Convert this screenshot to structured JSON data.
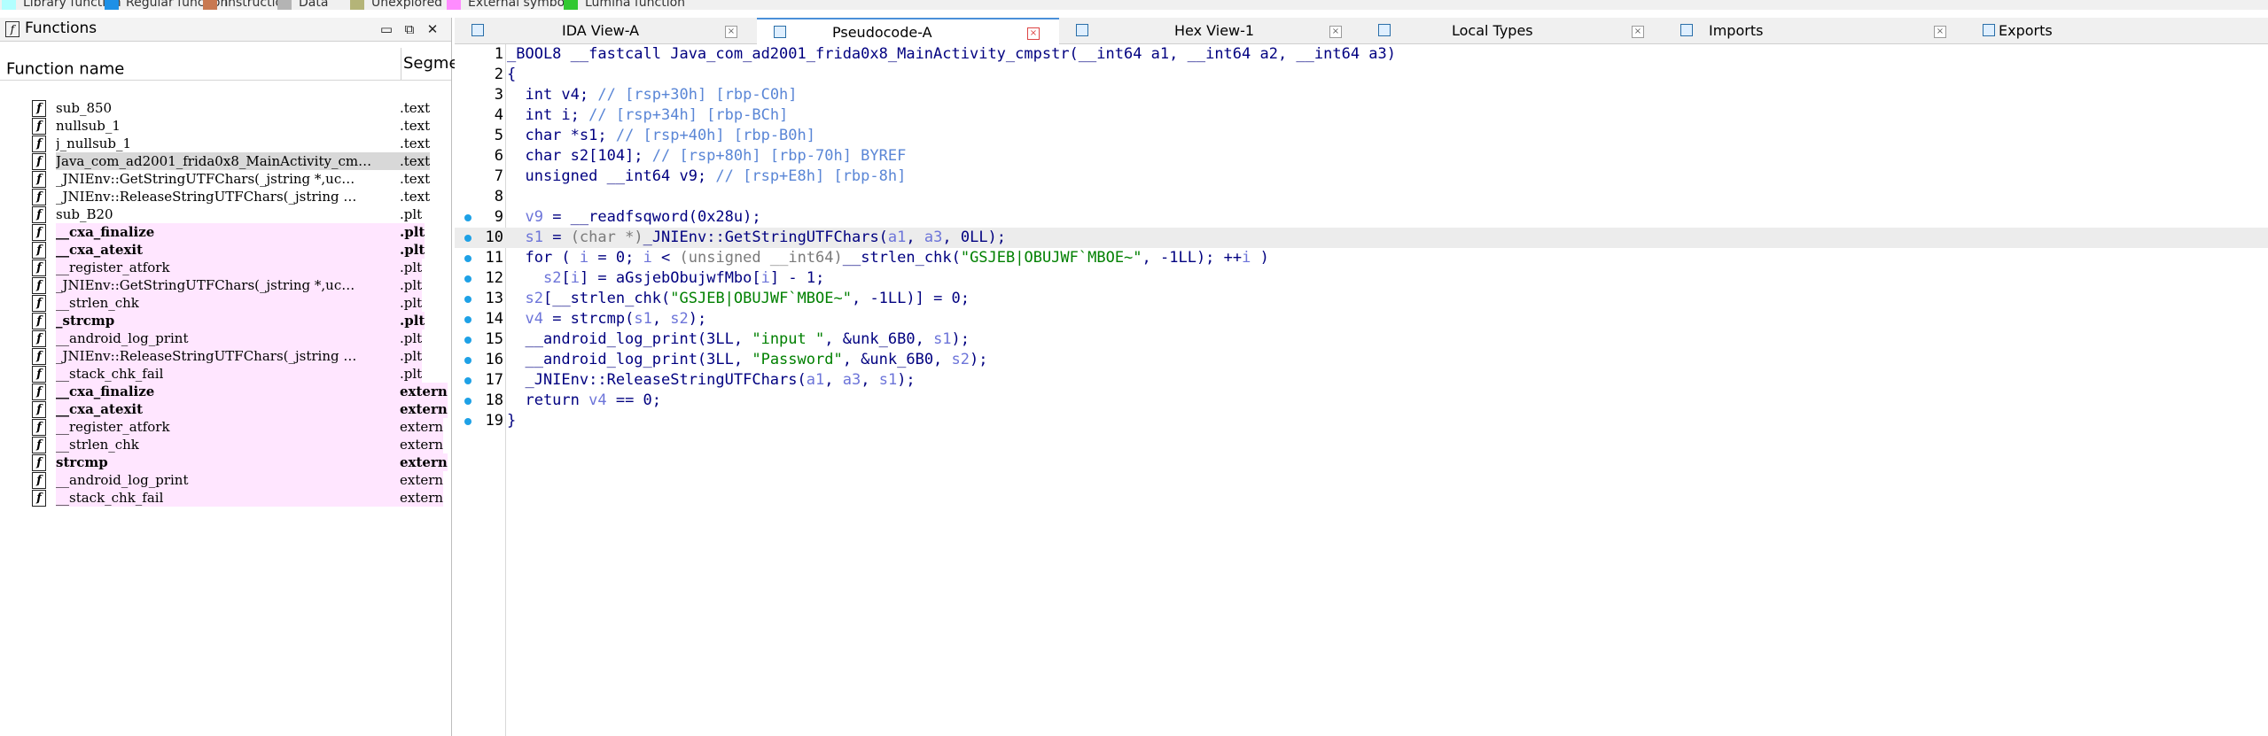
{
  "legend": [
    {
      "label": "Library function",
      "color": "#b2ffff"
    },
    {
      "label": "Regular function",
      "color": "#1e90e6"
    },
    {
      "label": "Instruction",
      "color": "#c87850"
    },
    {
      "label": "Data",
      "color": "#b4b4b4"
    },
    {
      "label": "Unexplored",
      "color": "#b4b478"
    },
    {
      "label": "External symbol",
      "color": "#ff8cff"
    },
    {
      "label": "Lumina function",
      "color": "#32c832"
    }
  ],
  "functions_panel": {
    "title": "Functions",
    "col_name": "Function name",
    "col_segment": "Segme",
    "rows": [
      {
        "name": "sub_850",
        "seg": ".text",
        "style": ""
      },
      {
        "name": "nullsub_1",
        "seg": ".text",
        "style": ""
      },
      {
        "name": "j_nullsub_1",
        "seg": ".text",
        "style": ""
      },
      {
        "name": "Java_com_ad2001_frida0x8_MainActivity_cm…",
        "seg": ".text",
        "style": "sel"
      },
      {
        "name": "_JNIEnv::GetStringUTFChars(_jstring *,uc…",
        "seg": ".text",
        "style": ""
      },
      {
        "name": "_JNIEnv::ReleaseStringUTFChars(_jstring …",
        "seg": ".text",
        "style": ""
      },
      {
        "name": "sub_B20",
        "seg": ".plt",
        "style": ""
      },
      {
        "name": "__cxa_finalize",
        "seg": ".plt",
        "style": "pink bold"
      },
      {
        "name": "__cxa_atexit",
        "seg": ".plt",
        "style": "pink bold"
      },
      {
        "name": "__register_atfork",
        "seg": ".plt",
        "style": "pink"
      },
      {
        "name": "_JNIEnv::GetStringUTFChars(_jstring *,uc…",
        "seg": ".plt",
        "style": "pink"
      },
      {
        "name": "__strlen_chk",
        "seg": ".plt",
        "style": "pink"
      },
      {
        "name": "_strcmp",
        "seg": ".plt",
        "style": "pink bold"
      },
      {
        "name": "__android_log_print",
        "seg": ".plt",
        "style": "pink"
      },
      {
        "name": "_JNIEnv::ReleaseStringUTFChars(_jstring …",
        "seg": ".plt",
        "style": "pink"
      },
      {
        "name": "__stack_chk_fail",
        "seg": ".plt",
        "style": "pink"
      },
      {
        "name": "__cxa_finalize",
        "seg": "extern",
        "style": "pink bold"
      },
      {
        "name": "__cxa_atexit",
        "seg": "extern",
        "style": "pink bold"
      },
      {
        "name": "__register_atfork",
        "seg": "extern",
        "style": "pink"
      },
      {
        "name": "__strlen_chk",
        "seg": "extern",
        "style": "pink"
      },
      {
        "name": "strcmp",
        "seg": "extern",
        "style": "pink bold"
      },
      {
        "name": "__android_log_print",
        "seg": "extern",
        "style": "pink"
      },
      {
        "name": "__stack_chk_fail",
        "seg": "extern",
        "style": "pink"
      }
    ]
  },
  "tabs": [
    {
      "label": "IDA View-A",
      "active": false
    },
    {
      "label": "Pseudocode-A",
      "active": true
    },
    {
      "label": "Hex View-1",
      "active": false
    },
    {
      "label": "Local Types",
      "active": false
    },
    {
      "label": "Imports",
      "active": false
    },
    {
      "label": "Exports",
      "active": false
    }
  ],
  "code_lines": [
    {
      "n": "1",
      "dot": false,
      "html": "_BOOL8 __fastcall Java_com_ad2001_frida0x8_MainActivity_cmpstr(__int64 a1, __int64 a2, __int64 a3)"
    },
    {
      "n": "2",
      "dot": false,
      "html": "{"
    },
    {
      "n": "3",
      "dot": false,
      "html": "  int v4; <span class=\"cm\">// [rsp+30h] [rbp-C0h]</span>"
    },
    {
      "n": "4",
      "dot": false,
      "html": "  int i; <span class=\"cm\">// [rsp+34h] [rbp-BCh]</span>"
    },
    {
      "n": "5",
      "dot": false,
      "html": "  char *s1; <span class=\"cm\">// [rsp+40h] [rbp-B0h]</span>"
    },
    {
      "n": "6",
      "dot": false,
      "html": "  char s2[104]; <span class=\"cm\">// [rsp+80h] [rbp-70h] BYREF</span>"
    },
    {
      "n": "7",
      "dot": false,
      "html": "  unsigned __int64 v9; <span class=\"cm\">// [rsp+E8h] [rbp-8h]</span>"
    },
    {
      "n": "8",
      "dot": false,
      "html": ""
    },
    {
      "n": "9",
      "dot": true,
      "html": "  <span class=\"var\">v9</span> = __readfsqword(0x28u);"
    },
    {
      "n": "10",
      "dot": true,
      "cur": true,
      "html": "  <span class=\"var\">s1</span> = <span class=\"gry\">(char *)</span>_JNIEnv::GetStringUTFChars(<span class=\"var\">a1</span>, <span class=\"var\">a3</span>, 0LL);"
    },
    {
      "n": "11",
      "dot": true,
      "html": "  for ( <span class=\"var\">i</span> = 0; <span class=\"var\">i</span> &lt; <span class=\"gry\">(unsigned __int64)</span>__strlen_chk(<span class=\"str\">\"GSJEB|OBUJWF`MBOE~\"</span>, -1LL); ++<span class=\"var\">i</span> )"
    },
    {
      "n": "12",
      "dot": true,
      "html": "    <span class=\"var\">s2</span>[<span class=\"var\">i</span>] = aGsjebObujwfMbo[<span class=\"var\">i</span>] - 1;"
    },
    {
      "n": "13",
      "dot": true,
      "html": "  <span class=\"var\">s2</span>[__strlen_chk(<span class=\"str\">\"GSJEB|OBUJWF`MBOE~\"</span>, -1LL)] = 0;"
    },
    {
      "n": "14",
      "dot": true,
      "html": "  <span class=\"var\">v4</span> = strcmp(<span class=\"var\">s1</span>, <span class=\"var\">s2</span>);"
    },
    {
      "n": "15",
      "dot": true,
      "html": "  __android_log_print(3LL, <span class=\"str\">\"input \"</span>, &amp;unk_6B0, <span class=\"var\">s1</span>);"
    },
    {
      "n": "16",
      "dot": true,
      "html": "  __android_log_print(3LL, <span class=\"str\">\"Password\"</span>, &amp;unk_6B0, <span class=\"var\">s2</span>);"
    },
    {
      "n": "17",
      "dot": true,
      "html": "  _JNIEnv::ReleaseStringUTFChars(<span class=\"var\">a1</span>, <span class=\"var\">a3</span>, <span class=\"var\">s1</span>);"
    },
    {
      "n": "18",
      "dot": true,
      "html": "  return <span class=\"var\">v4</span> == 0;"
    },
    {
      "n": "19",
      "dot": true,
      "html": "}"
    }
  ]
}
